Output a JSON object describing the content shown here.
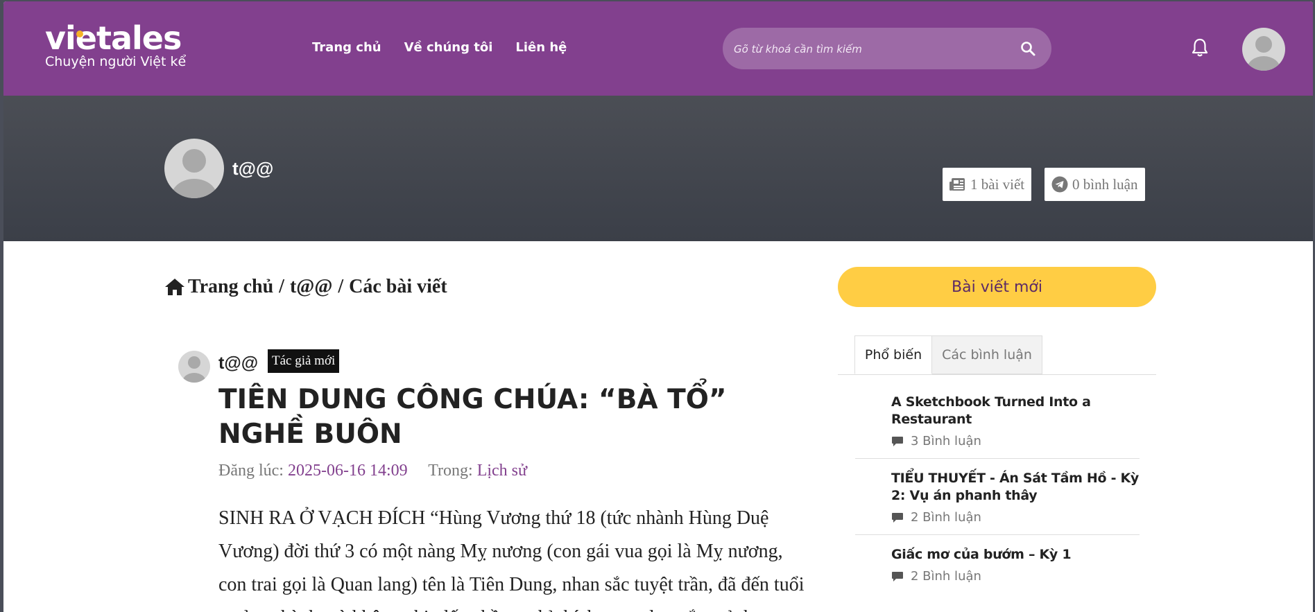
{
  "header": {
    "logo_text": "vietales",
    "tagline": "Chuyện người Việt kể",
    "nav": [
      {
        "label": "Trang chủ"
      },
      {
        "label": "Về chúng tôi"
      },
      {
        "label": "Liên hệ"
      }
    ],
    "search_placeholder": "Gõ từ khoá cần tìm kiếm"
  },
  "profile": {
    "name": "t@@",
    "posts_count": "1 bài viết",
    "comments_count": "0 bình luận"
  },
  "breadcrumb": {
    "home": "Trang chủ",
    "sep": "/",
    "user": "t@@",
    "current": "Các bài viết"
  },
  "post": {
    "author": "t@@",
    "badge": "Tác giả mới",
    "title": "TIÊN DUNG CÔNG CHÚA: “BÀ TỔ” NGHỀ BUÔN",
    "date_label": "Đăng lúc:",
    "date": "2025-06-16 14:09",
    "category_label": "Trong:",
    "category": "Lịch sử",
    "excerpt": "SINH RA Ở VẠCH ĐÍCH “Hùng Vương thứ 18 (tức nhành Hùng Duệ Vương) đời thứ 3 có một nàng Mỵ nương (con gái vua gọi là Mỵ nương, con trai gọi là Quan lang) tên là Tiên Dung, nhan sắc tuyệt trần, đã đến tuổi trưởng thành mà không chịu lấy chồng, chỉ thích ngao du ngắm cảnh"
  },
  "sidebar": {
    "new_post_button": "Bài viết mới",
    "tabs": [
      {
        "label": "Phổ biến"
      },
      {
        "label": "Các bình luận"
      }
    ],
    "popular": [
      {
        "title": "A Sketchbook Turned Into a Restaurant",
        "comments": "3 Bình luận"
      },
      {
        "title": "TIỂU THUYẾT - Án Sát Tầm Hồ - Kỳ 2: Vụ án phanh thây",
        "comments": "2 Bình luận"
      },
      {
        "title": "Giấc mơ của bướm – Kỳ 1",
        "comments": "2 Bình luận"
      }
    ]
  },
  "colors": {
    "brand": "#82408e",
    "accent_yellow": "#ffcd44",
    "logo_dot": "#f6b227",
    "profile_band": "#44474f"
  }
}
